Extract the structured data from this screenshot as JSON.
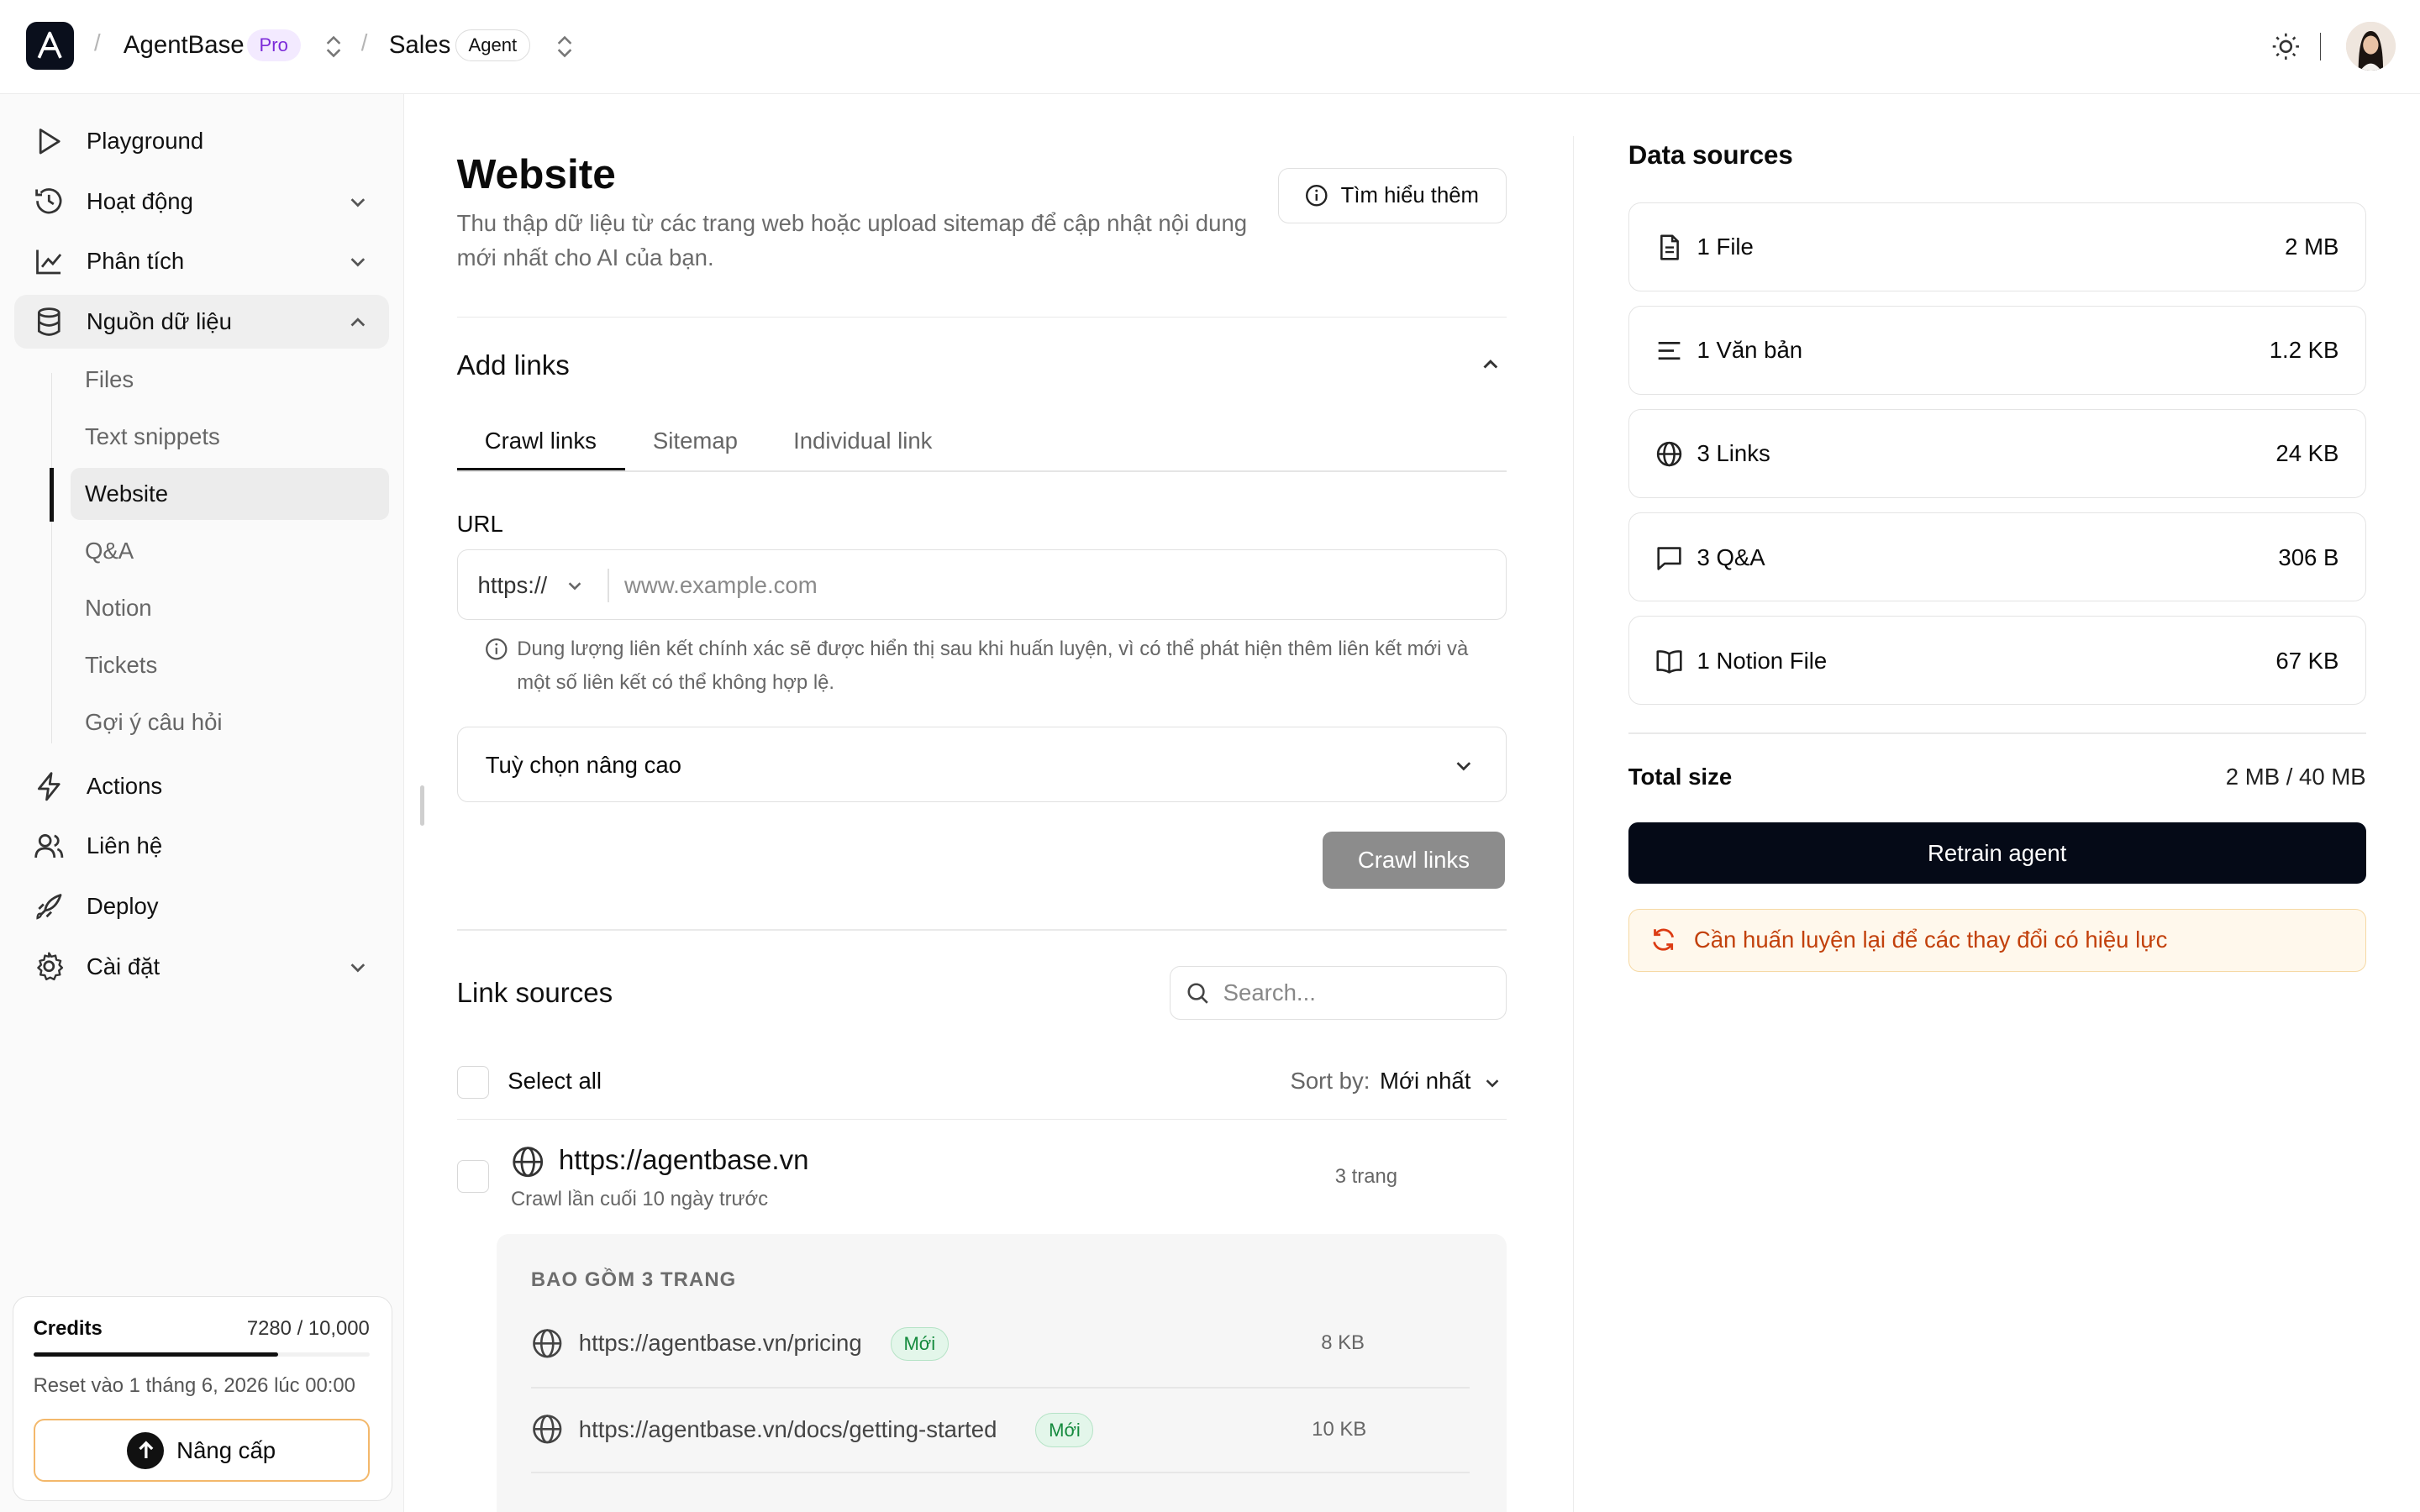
{
  "header": {
    "logo_letter": "A",
    "workspace": "AgentBase",
    "plan_badge": "Pro",
    "agent_name": "Sales",
    "agent_badge": "Agent"
  },
  "sidebar": {
    "items": [
      {
        "label": "Playground",
        "icon": "play-icon"
      },
      {
        "label": "Hoạt động",
        "icon": "history-icon"
      },
      {
        "label": "Phân tích",
        "icon": "chart-icon"
      },
      {
        "label": "Nguồn dữ liệu",
        "icon": "database-icon"
      },
      {
        "label": "Actions",
        "icon": "lightning-icon"
      },
      {
        "label": "Liên hệ",
        "icon": "users-icon"
      },
      {
        "label": "Deploy",
        "icon": "rocket-icon"
      },
      {
        "label": "Cài đặt",
        "icon": "gear-icon"
      }
    ],
    "sub_items": [
      "Files",
      "Text snippets",
      "Website",
      "Q&A",
      "Notion",
      "Tickets",
      "Gợi ý câu hỏi"
    ],
    "active_sub": "Website"
  },
  "credits": {
    "label": "Credits",
    "value": "7280 / 10,000",
    "used_fraction": 0.728,
    "reset": "Reset vào 1 tháng 6, 2026 lúc 00:00",
    "upgrade": "Nâng cấp"
  },
  "main": {
    "title": "Website",
    "description": "Thu thập dữ liệu từ các trang web hoặc upload sitemap để cập nhật nội dung mới nhất cho AI của bạn.",
    "learn_more": "Tìm hiểu thêm",
    "add_links": "Add links",
    "tabs": [
      "Crawl links",
      "Sitemap",
      "Individual link"
    ],
    "url_label": "URL",
    "protocol": "https://",
    "url_placeholder": "www.example.com",
    "hint": "Dung lượng liên kết chính xác sẽ được hiển thị sau khi huấn luyện, vì có thể phát hiện thêm liên kết mới và một số liên kết có thể không hợp lệ.",
    "advanced": "Tuỳ chọn nâng cao",
    "crawl_button": "Crawl links",
    "link_sources": "Link sources",
    "search_placeholder": "Search...",
    "select_all": "Select all",
    "sort_by": "Sort by:",
    "sort_value": "Mới nhất",
    "site": {
      "url": "https://agentbase.vn",
      "last_crawl": "Crawl lần cuối 10 ngày trước",
      "pages": "3 trang",
      "includes": "BAO GỒM 3 TRANG",
      "children": [
        {
          "url": "https://agentbase.vn/pricing",
          "badge": "Mới",
          "size": "8 KB"
        },
        {
          "url": "https://agentbase.vn/docs/getting-started",
          "badge": "Mới",
          "size": "10 KB"
        }
      ]
    }
  },
  "data_sources": {
    "title": "Data sources",
    "items": [
      {
        "label": "1 File",
        "size": "2 MB",
        "icon": "file-icon"
      },
      {
        "label": "1 Văn bản",
        "size": "1.2 KB",
        "icon": "text-lines-icon"
      },
      {
        "label": "3 Links",
        "size": "24 KB",
        "icon": "globe-icon"
      },
      {
        "label": "3 Q&A",
        "size": "306 B",
        "icon": "chat-icon"
      },
      {
        "label": "1 Notion File",
        "size": "67 KB",
        "icon": "book-icon"
      }
    ],
    "total_label": "Total size",
    "total_value": "2 MB / 40 MB",
    "retrain": "Retrain agent",
    "warning": "Cần huấn luyện lại để các thay đổi có hiệu lực"
  }
}
